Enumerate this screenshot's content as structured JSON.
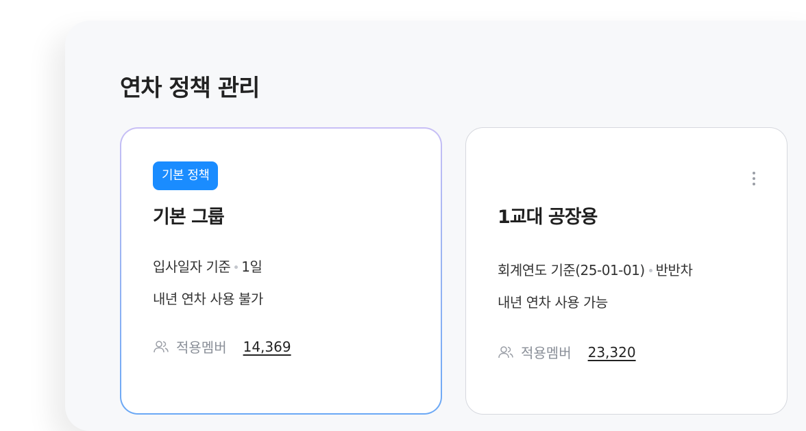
{
  "page": {
    "title": "연차 정책 관리"
  },
  "policies": [
    {
      "badge": "기본 정책",
      "name": "기본 그룹",
      "basis": "입사일자 기준",
      "unit": "1일",
      "next_year": "내년 연차 사용 불가",
      "members_label": "적용멤버",
      "members_count": "14,369"
    },
    {
      "name": "1교대 공장용",
      "basis": "회계연도 기준(25-01-01)",
      "unit": "반반차",
      "next_year": "내년 연차 사용 가능",
      "members_label": "적용멤버",
      "members_count": "23,320"
    }
  ],
  "icons": {
    "members": "people-icon",
    "more": "more-vertical-icon"
  },
  "colors": {
    "badge_bg": "#1a8cff",
    "selected_border_top": "#c8bff5",
    "selected_border_bottom": "#6aa8f5"
  }
}
